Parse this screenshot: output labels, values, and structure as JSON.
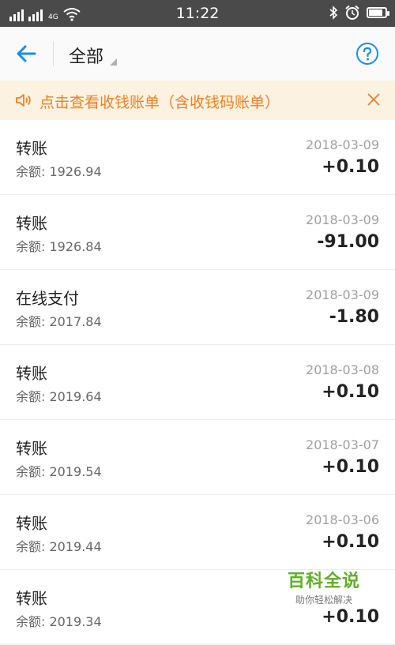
{
  "status_bar": {
    "time": "11:22",
    "network_label": "4G",
    "battery_level": 0.85,
    "icons": [
      "signal-icon",
      "signal-icon",
      "wifi-icon",
      "bluetooth-icon",
      "alarm-icon",
      "battery-icon"
    ]
  },
  "nav": {
    "title": "全部",
    "icons": [
      "back-arrow-icon",
      "dropdown-triangle-icon",
      "help-icon"
    ]
  },
  "notice": {
    "text": "点击查看收钱账单（含收钱码账单）",
    "icons": [
      "speaker-icon",
      "close-icon"
    ]
  },
  "transactions": [
    {
      "title": "转账",
      "balance": "余额: 1926.94",
      "date": "2018-03-09",
      "amount": "+0.10"
    },
    {
      "title": "转账",
      "balance": "余额: 1926.84",
      "date": "2018-03-09",
      "amount": "-91.00"
    },
    {
      "title": "在线支付",
      "balance": "余额: 2017.84",
      "date": "2018-03-09",
      "amount": "-1.80"
    },
    {
      "title": "转账",
      "balance": "余额: 2019.64",
      "date": "2018-03-08",
      "amount": "+0.10"
    },
    {
      "title": "转账",
      "balance": "余额: 2019.54",
      "date": "2018-03-07",
      "amount": "+0.10"
    },
    {
      "title": "转账",
      "balance": "余额: 2019.44",
      "date": "2018-03-06",
      "amount": "+0.10"
    },
    {
      "title": "转账",
      "balance": "余额: 2019.34",
      "date": "",
      "amount": "+0.10"
    }
  ],
  "watermark": {
    "title": "百科全说",
    "subtitle": "助你轻松解决"
  },
  "colors": {
    "accent": "#1a8ee8",
    "notice_text": "#f08022",
    "notice_bg": "#fcf2e1",
    "watermark": "#5fae27"
  }
}
